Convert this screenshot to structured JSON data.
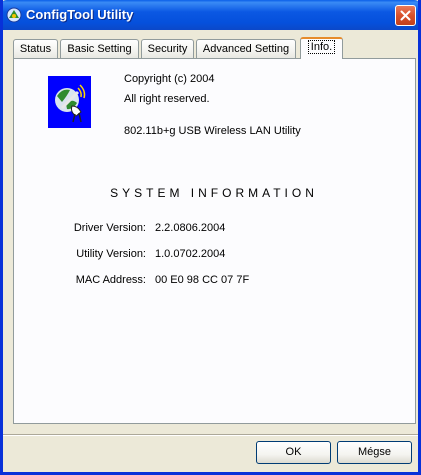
{
  "window": {
    "title": "ConfigTool Utility"
  },
  "tabs": [
    {
      "label": "Status"
    },
    {
      "label": "Basic Setting"
    },
    {
      "label": "Security"
    },
    {
      "label": "Advanced Setting"
    },
    {
      "label": "Info."
    }
  ],
  "active_tab": "Info.",
  "info": {
    "copyright": "Copyright (c) 2004",
    "rights": "All right reserved.",
    "product": "802.11b+g USB Wireless LAN Utility"
  },
  "system": {
    "title": "SYSTEM INFORMATION",
    "rows": [
      {
        "label": "Driver Version:",
        "value": "2.2.0806.2004"
      },
      {
        "label": "Utility Version:",
        "value": "1.0.0702.2004"
      },
      {
        "label": "MAC Address:",
        "value": "00 E0 98 CC 07 7F"
      }
    ]
  },
  "buttons": {
    "ok": "OK",
    "cancel": "Mégse"
  },
  "icons": {
    "title": "config-tool-icon",
    "close": "close-icon",
    "logo": "wireless-satellite-icon"
  },
  "colors": {
    "titlebar": "#0550dc",
    "close": "#d9512b",
    "active_tab_accent": "#e68b2c",
    "logo_bg": "#0000ff"
  }
}
